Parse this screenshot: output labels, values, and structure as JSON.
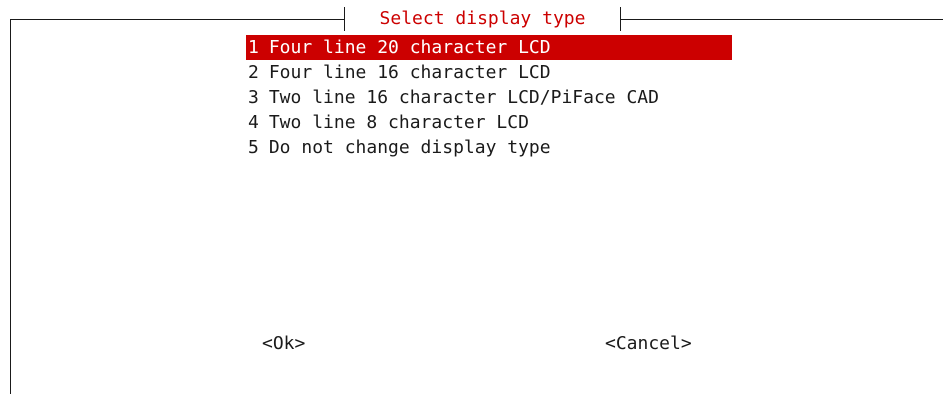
{
  "dialog": {
    "title": "Select display type"
  },
  "menu": {
    "items": [
      {
        "number": "1",
        "label": "Four line 20 character LCD",
        "selected": true
      },
      {
        "number": "2",
        "label": "Four line 16 character LCD",
        "selected": false
      },
      {
        "number": "3",
        "label": "Two line 16 character LCD/PiFace CAD",
        "selected": false
      },
      {
        "number": "4",
        "label": "Two line 8 character LCD",
        "selected": false
      },
      {
        "number": "5",
        "label": "Do not change display type",
        "selected": false
      }
    ]
  },
  "buttons": {
    "ok_label": "<Ok>",
    "cancel_label": "<Cancel>"
  },
  "colors": {
    "accent": "#cc0000",
    "selected_text": "#ffffff",
    "text": "#1a1a1a",
    "background": "#ffffff"
  }
}
